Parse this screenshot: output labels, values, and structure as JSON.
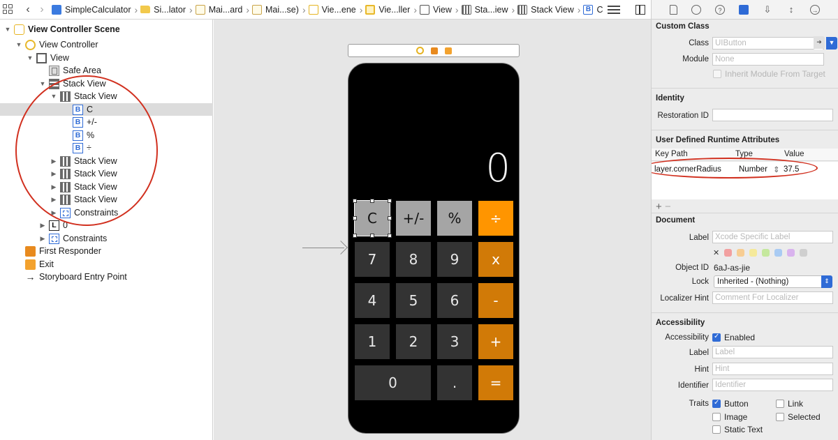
{
  "jumpbar": {
    "crumbs": [
      {
        "label": "SimpleCalculator",
        "icon": "project-icon"
      },
      {
        "label": "Si...lator",
        "icon": "folder-icon"
      },
      {
        "label": "Mai...ard",
        "icon": "storyboard-icon"
      },
      {
        "label": "Mai...se)",
        "icon": "storyboard-icon"
      },
      {
        "label": "Vie...ene",
        "icon": "scene-icon"
      },
      {
        "label": "Vie...ller",
        "icon": "view-controller-icon"
      },
      {
        "label": "View",
        "icon": "view-icon"
      },
      {
        "label": "Sta...iew",
        "icon": "stack-view-icon"
      },
      {
        "label": "Stack View",
        "icon": "stack-view-icon"
      },
      {
        "label": "C",
        "icon": "button-icon"
      }
    ]
  },
  "outline": {
    "rows": [
      {
        "label": "View Controller Scene",
        "icon": "scene",
        "expanded": true
      },
      {
        "label": "View Controller",
        "icon": "vc",
        "expanded": true
      },
      {
        "label": "View",
        "icon": "view",
        "expanded": true
      },
      {
        "label": "Safe Area",
        "icon": "safe"
      },
      {
        "label": "Stack View",
        "icon": "vstack",
        "expanded": true
      },
      {
        "label": "Stack View",
        "icon": "hstack",
        "expanded": true
      },
      {
        "label": "C",
        "icon": "btn",
        "selected": true
      },
      {
        "label": "+/-",
        "icon": "btn"
      },
      {
        "label": "%",
        "icon": "btn"
      },
      {
        "label": "÷",
        "icon": "btn"
      },
      {
        "label": "Stack View",
        "icon": "hstack",
        "expanded": false
      },
      {
        "label": "Stack View",
        "icon": "hstack",
        "expanded": false
      },
      {
        "label": "Stack View",
        "icon": "hstack",
        "expanded": false
      },
      {
        "label": "Stack View",
        "icon": "hstack",
        "expanded": false
      },
      {
        "label": "Constraints",
        "icon": "cons",
        "expanded": false
      },
      {
        "label": "0",
        "icon": "lbl",
        "expanded": false
      },
      {
        "label": "Constraints",
        "icon": "cons",
        "expanded": false
      },
      {
        "label": "First Responder",
        "icon": "fr"
      },
      {
        "label": "Exit",
        "icon": "exit"
      },
      {
        "label": "Storyboard Entry Point",
        "icon": "arrow"
      }
    ]
  },
  "calculator": {
    "display": "0",
    "keys": {
      "clear": "C",
      "sign": "+/-",
      "percent": "%",
      "divide": "÷",
      "seven": "7",
      "eight": "8",
      "nine": "9",
      "multiply": "x",
      "four": "4",
      "five": "5",
      "six": "6",
      "minus": "-",
      "one": "1",
      "two": "2",
      "three": "3",
      "plus": "+",
      "zero": "0",
      "dot": ".",
      "equals": "="
    },
    "colors": {
      "operator": "#ff9500",
      "function": "#a5a5a5",
      "number": "#333333"
    }
  },
  "inspector": {
    "custom_class": {
      "title": "Custom Class",
      "class_label": "Class",
      "class_placeholder": "UIButton",
      "module_label": "Module",
      "module_placeholder": "None",
      "inherit_label": "Inherit Module From Target"
    },
    "identity": {
      "title": "Identity",
      "restoration_label": "Restoration ID"
    },
    "runtime": {
      "title": "User Defined Runtime Attributes",
      "headers": {
        "key": "Key Path",
        "type": "Type",
        "value": "Value"
      },
      "row": {
        "key": "layer.cornerRadius",
        "type": "Number",
        "value": "37.5"
      }
    },
    "document": {
      "title": "Document",
      "label_label": "Label",
      "label_placeholder": "Xcode Specific Label",
      "object_id_label": "Object ID",
      "object_id": "6aJ-as-jie",
      "lock_label": "Lock",
      "lock_value": "Inherited - (Nothing)",
      "localizer_label": "Localizer Hint",
      "localizer_placeholder": "Comment For Localizer"
    },
    "accessibility": {
      "title": "Accessibility",
      "accessibility_label": "Accessibility",
      "enabled": "Enabled",
      "label_label": "Label",
      "label_placeholder": "Label",
      "hint_label": "Hint",
      "hint_placeholder": "Hint",
      "identifier_label": "Identifier",
      "identifier_placeholder": "Identifier",
      "traits_label": "Traits",
      "traits": [
        "Button",
        "Link",
        "Image",
        "Selected",
        "Static Text"
      ]
    }
  },
  "annotation_color": "#d1301f"
}
